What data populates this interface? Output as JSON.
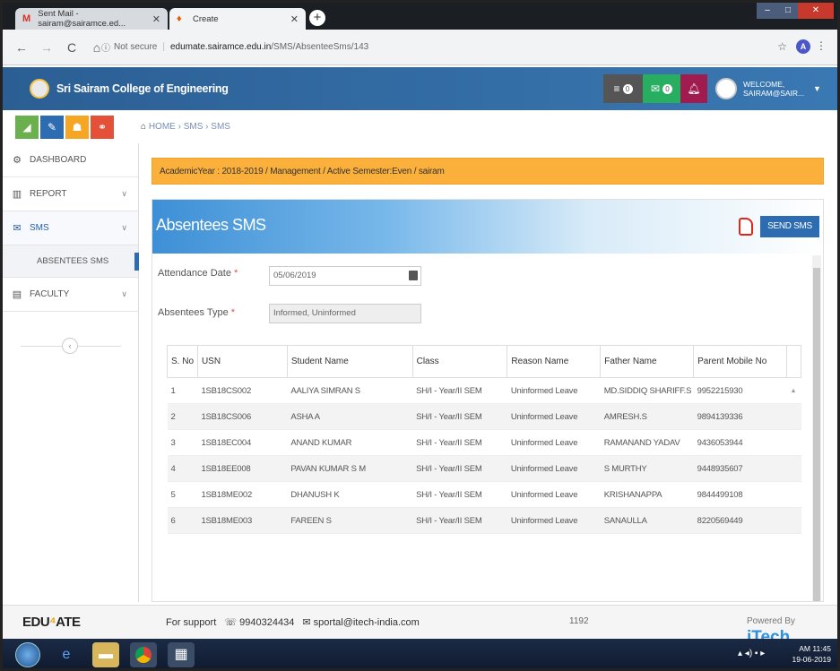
{
  "browser": {
    "tabs": [
      {
        "label": "Sent Mail - sairam@sairamce.ed...",
        "icon": "gmail-icon"
      },
      {
        "label": "Create",
        "icon": "flame-icon"
      }
    ],
    "address": {
      "security": "Not secure",
      "host": "edumate.sairamce.edu.in",
      "path": "/SMS/AbsenteeSms/143"
    },
    "profile_initial": "A"
  },
  "app": {
    "college_name": "Sri Sairam College of Engineering",
    "badges": {
      "messages": "0",
      "mail": "0"
    },
    "welcome_line1": "WELCOME,",
    "welcome_line2": "SAIRAM@SAIR..."
  },
  "breadcrumb": "HOME  ›  SMS  ›  SMS",
  "sidebar": {
    "items": [
      {
        "label": "DASHBOARD"
      },
      {
        "label": "REPORT"
      },
      {
        "label": "SMS"
      },
      {
        "label": "FACULTY"
      }
    ],
    "sub_item": "ABSENTEES SMS"
  },
  "banner": "AcademicYear : 2018-2019 / Management / Active Semester:Even / sairam",
  "panel": {
    "title": "Absentees SMS",
    "send_button": "SEND SMS",
    "attendance_label": "Attendance Date",
    "attendance_value": "05/06/2019",
    "absentee_label": "Absentees Type",
    "absentee_value": "Informed, Uninformed",
    "required_mark": "*"
  },
  "table": {
    "headers": [
      "S. No",
      "USN",
      "Student Name",
      "Class",
      "Reason Name",
      "Father Name",
      "Parent Mobile No"
    ],
    "rows": [
      [
        "1",
        "1SB18CS002",
        "AALIYA SIMRAN S",
        "SH/I - Year/II SEM",
        "Uninformed Leave",
        "MD.SIDDIQ SHARIFF.S",
        "9952215930"
      ],
      [
        "2",
        "1SB18CS006",
        "ASHA A",
        "SH/I - Year/II SEM",
        "Uninformed Leave",
        "AMRESH.S",
        "9894139336"
      ],
      [
        "3",
        "1SB18EC004",
        "ANAND KUMAR",
        "SH/I - Year/II SEM",
        "Uninformed Leave",
        "RAMANAND YADAV",
        "9436053944"
      ],
      [
        "4",
        "1SB18EE008",
        "PAVAN KUMAR S M",
        "SH/I - Year/II SEM",
        "Uninformed Leave",
        "S MURTHY",
        "9448935607"
      ],
      [
        "5",
        "1SB18ME002",
        "DHANUSH K",
        "SH/I - Year/II SEM",
        "Uninformed Leave",
        "KRISHANAPPA",
        "9844499108"
      ],
      [
        "6",
        "1SB18ME003",
        "FAREEN S",
        "SH/I - Year/II SEM",
        "Uninformed Leave",
        "SANAULLA",
        "8220569449"
      ]
    ]
  },
  "footer": {
    "logo_left": "EDU",
    "logo_right": "ATE",
    "support_text": "For support",
    "phone": "9940324434",
    "email": "sportal@itech-india.com",
    "count": "1192",
    "powered": "Powered By",
    "brand": "iTech"
  },
  "taskbar": {
    "time": "AM 11:45",
    "date": "19-06-2019"
  }
}
